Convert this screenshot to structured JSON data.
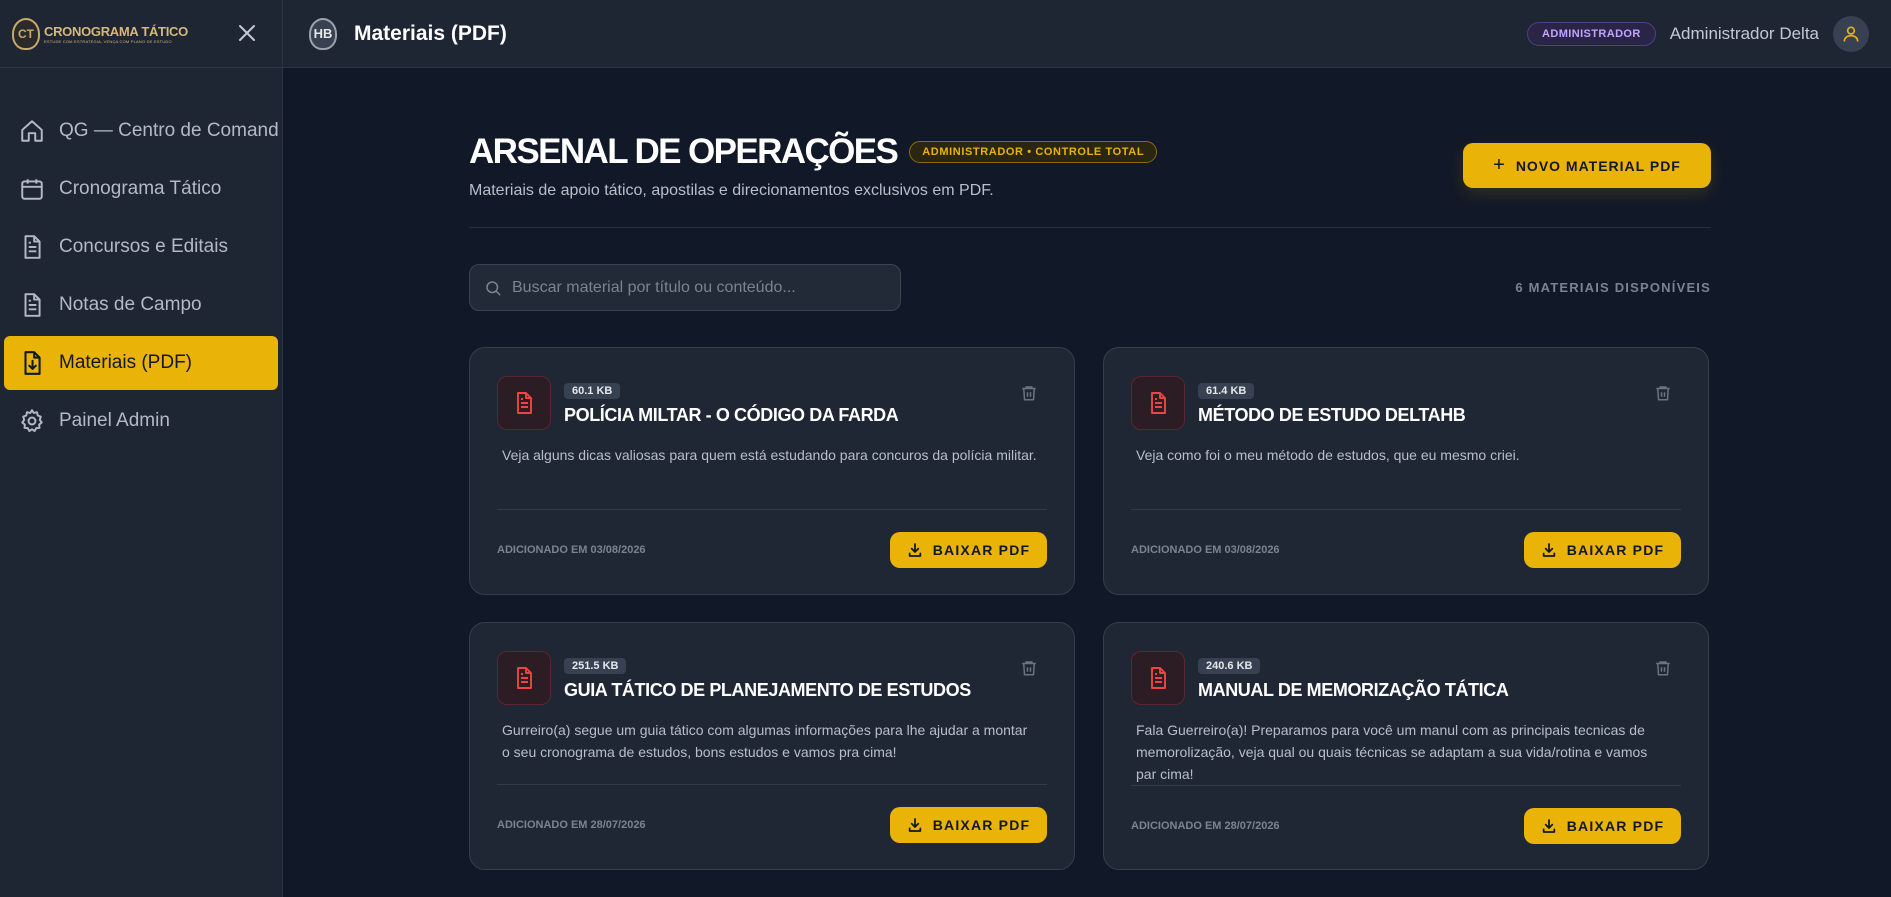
{
  "brand": {
    "title": "CRONOGRAMA TÁTICO",
    "subtitle": "ESTUDE COM ESTRATÉGIA, VENÇA COM PLANO DE ESTUDO",
    "logo_text": "CT"
  },
  "sidebar": {
    "items": [
      {
        "label": "QG — Centro de Comando",
        "icon": "home-icon"
      },
      {
        "label": "Cronograma Tático",
        "icon": "calendar-icon"
      },
      {
        "label": "Concursos e Editais",
        "icon": "document-icon"
      },
      {
        "label": "Notas de Campo",
        "icon": "document-icon"
      },
      {
        "label": "Materiais (PDF)",
        "icon": "file-download-icon",
        "active": true
      },
      {
        "label": "Painel Admin",
        "icon": "gear-icon"
      }
    ]
  },
  "topbar": {
    "logo_text": "HB",
    "title": "Materiais (PDF)",
    "role_badge": "ADMINISTRADOR",
    "user_name": "Administrador Delta"
  },
  "page": {
    "title": "ARSENAL DE OPERAÇÕES",
    "chip": "ADMINISTRADOR • CONTROLE TOTAL",
    "subtitle": "Materiais de apoio tático, apostilas e direcionamentos exclusivos em PDF.",
    "new_button": "NOVO MATERIAL PDF",
    "search_placeholder": "Buscar material por título ou conteúdo...",
    "count_label": "6 MATERIAIS DISPONÍVEIS"
  },
  "materials": [
    {
      "size": "60.1 KB",
      "title": "POLÍCIA MILTAR - O CÓDIGO DA FARDA",
      "description": "Veja alguns dicas valiosas para quem está estudando para concuros da polícia militar.",
      "added": "ADICIONADO EM 03/08/2026",
      "button": "BAIXAR PDF"
    },
    {
      "size": "61.4 KB",
      "title": "MÉTODO DE ESTUDO DELTAHB",
      "description": "Veja como foi o meu método de estudos, que eu mesmo criei.",
      "added": "ADICIONADO EM 03/08/2026",
      "button": "BAIXAR PDF"
    },
    {
      "size": "251.5 KB",
      "title": "GUIA TÁTICO DE PLANEJAMENTO DE ESTUDOS",
      "description": "Gurreiro(a) segue um guia tático com algumas informações para lhe ajudar a montar o seu cronograma de estudos, bons estudos e vamos pra cima!",
      "added": "ADICIONADO EM 28/07/2026",
      "button": "BAIXAR PDF"
    },
    {
      "size": "240.6 KB",
      "title": "MANUAL DE MEMORIZAÇÃO TÁTICA",
      "description": "Fala Guerreiro(a)! Preparamos para você um manul com as principais tecnicas de memorolização, veja qual ou quais técnicas se adaptam a sua vida/rotina e vamos par cima!",
      "added": "ADICIONADO EM 28/07/2026",
      "button": "BAIXAR PDF"
    }
  ],
  "colors": {
    "accent": "#eab308",
    "background": "#111827",
    "panel": "#1e2533",
    "card": "#1f2735",
    "pdf_red": "#ef4444",
    "role_purple": "#c4a3ff"
  }
}
